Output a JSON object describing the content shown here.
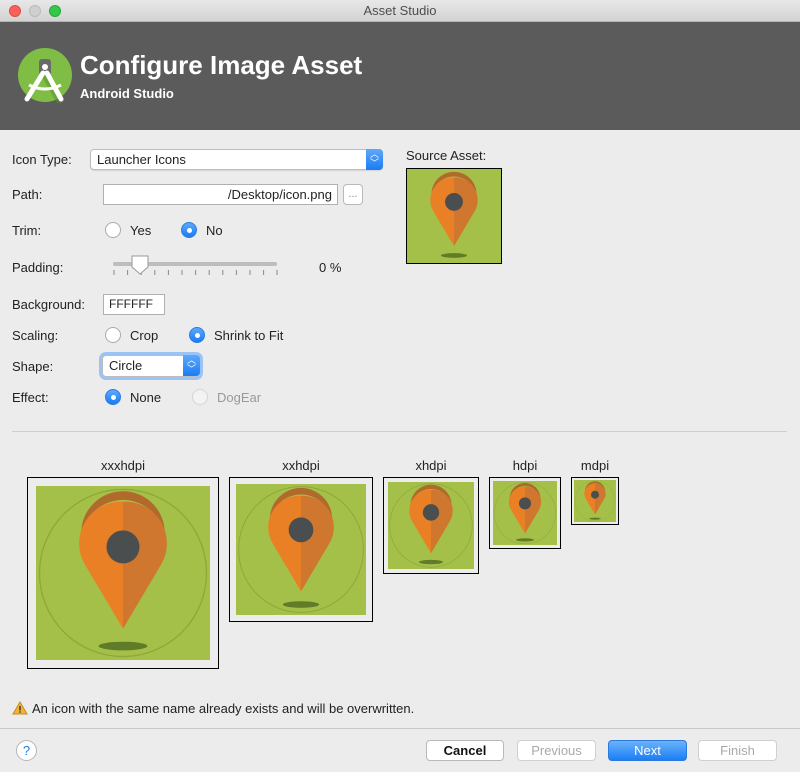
{
  "window": {
    "title": "Asset Studio"
  },
  "header": {
    "title": "Configure Image Asset",
    "subtitle": "Android Studio"
  },
  "form": {
    "icon_type_label": "Icon Type:",
    "icon_type_value": "Launcher Icons",
    "path_label": "Path:",
    "path_value": "/Desktop/icon.png",
    "browse_label": "...",
    "trim_label": "Trim:",
    "trim_yes": "Yes",
    "trim_no": "No",
    "trim_selected": "No",
    "padding_label": "Padding:",
    "padding_value": "0 %",
    "padding_percent": 0,
    "background_label": "Background:",
    "background_value": "FFFFFF",
    "scaling_label": "Scaling:",
    "scaling_crop": "Crop",
    "scaling_shrink": "Shrink to Fit",
    "scaling_selected": "Shrink to Fit",
    "shape_label": "Shape:",
    "shape_value": "Circle",
    "effect_label": "Effect:",
    "effect_none": "None",
    "effect_dogear": "DogEar",
    "effect_selected": "None"
  },
  "source": {
    "label": "Source Asset:"
  },
  "previews": [
    {
      "label": "xxxhdpi"
    },
    {
      "label": "xxhdpi"
    },
    {
      "label": "xhdpi"
    },
    {
      "label": "hdpi"
    },
    {
      "label": "mdpi"
    }
  ],
  "warning": "An icon with the same name already exists and will be overwritten.",
  "footer": {
    "help": "?",
    "cancel": "Cancel",
    "previous": "Previous",
    "next": "Next",
    "finish": "Finish"
  },
  "colors": {
    "accent": "#1a7cf4",
    "header": "#5b5b5b",
    "icon_bg": "#a5c049",
    "pin": "#e98025",
    "pin_dark": "#cf772f",
    "dot": "#4a4e4f"
  }
}
